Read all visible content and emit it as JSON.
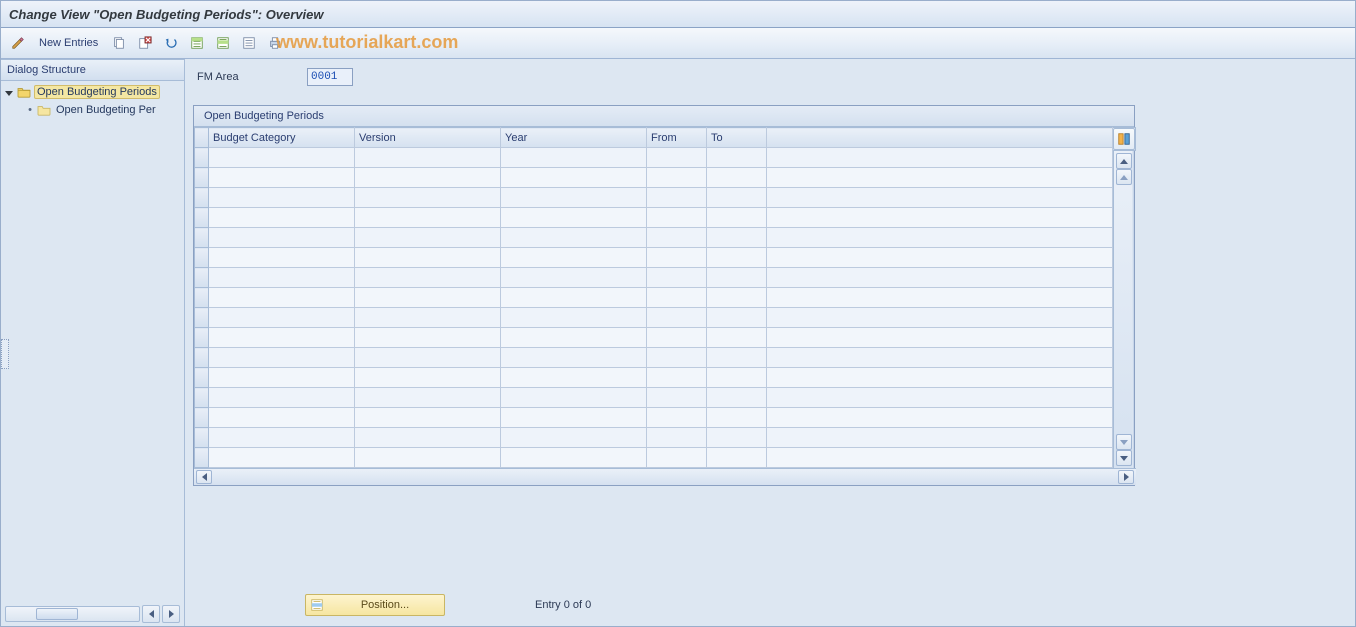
{
  "title": "Change View \"Open Budgeting Periods\": Overview",
  "watermark": "www.tutorialkart.com",
  "toolbar": {
    "new_entries": "New Entries"
  },
  "sidebar": {
    "header": "Dialog Structure",
    "items": [
      {
        "label": "Open Budgeting Periods",
        "selected": true,
        "icon": "folder-open"
      },
      {
        "label": "Open Budgeting Per",
        "selected": false,
        "icon": "folder"
      }
    ]
  },
  "fields": {
    "fm_area_label": "FM Area",
    "fm_area_value": "0001"
  },
  "table": {
    "title": "Open Budgeting Periods",
    "columns": {
      "budget_category": "Budget Category",
      "version": "Version",
      "year": "Year",
      "from": "From",
      "to": "To"
    },
    "row_count": 16,
    "rows": []
  },
  "footer": {
    "position_label": "Position...",
    "entry_status": "Entry 0 of 0"
  }
}
